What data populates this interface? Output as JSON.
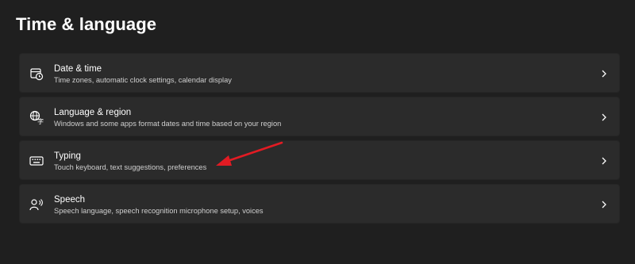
{
  "page": {
    "title": "Time & language"
  },
  "items": [
    {
      "title": "Date & time",
      "subtitle": "Time zones, automatic clock settings, calendar display",
      "icon": "calendar-clock-icon"
    },
    {
      "title": "Language & region",
      "subtitle": "Windows and some apps format dates and time based on your region",
      "icon": "globe-language-icon"
    },
    {
      "title": "Typing",
      "subtitle": "Touch keyboard, text suggestions, preferences",
      "icon": "keyboard-icon"
    },
    {
      "title": "Speech",
      "subtitle": "Speech language, speech recognition microphone setup, voices",
      "icon": "speech-icon"
    }
  ],
  "colors": {
    "background": "#1f1f1f",
    "card": "#2b2b2b",
    "annotation_arrow": "#e21b23"
  }
}
